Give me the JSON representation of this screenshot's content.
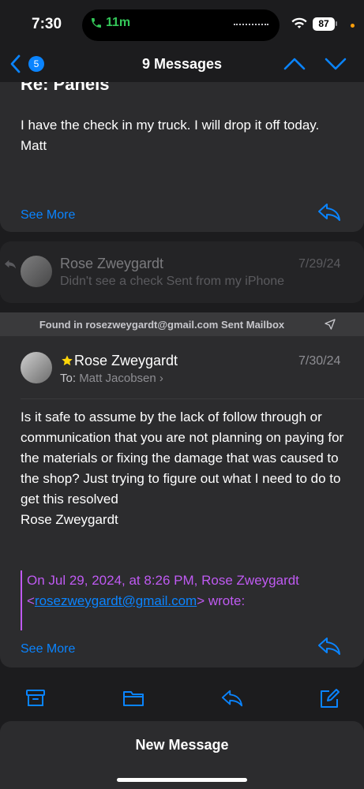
{
  "status": {
    "time": "7:30",
    "call": "11m",
    "battery": "87"
  },
  "nav": {
    "back_count": "5",
    "title": "9 Messages"
  },
  "message1": {
    "subject": "Re: Panels",
    "body": "I have the check in my truck.  I will drop it off today.\nMatt",
    "see_more": "See More"
  },
  "message2": {
    "sender": "Rose Zweygardt",
    "date": "7/29/24",
    "preview": "Didn't see a check Sent from my iPhone"
  },
  "found_in": "Found in rosezweygardt@gmail.com Sent Mailbox",
  "message3": {
    "sender": "Rose Zweygardt",
    "date": "7/30/24",
    "to_label": "To:",
    "to_name": "Matt Jacobsen",
    "body": "Is it safe to assume by the lack of follow through or communication that you are not planning on paying for the materials or fixing the damage that was caused to the shop? Just trying to figure out what I need to do to get this resolved\nRose Zweygardt",
    "quote_line1": "On Jul 29, 2024, at 8:26 PM, Rose Zweygardt",
    "quote_open": "<",
    "quote_email": "rosezweygardt@gmail.com",
    "quote_close": "> wrote:",
    "see_more": "See More"
  },
  "toolbar": {
    "new_message": "New Message"
  },
  "colors": {
    "accent": "#0a84ff",
    "quote": "#bf5af2",
    "star": "#ffd60a",
    "call": "#34c759"
  },
  "icons": [
    "phone-icon",
    "wifi-icon",
    "chevron-left-icon",
    "chevron-up-icon",
    "chevron-down-icon",
    "reply-icon",
    "star-icon",
    "send-arrow-icon",
    "archive-icon",
    "folder-icon",
    "compose-icon"
  ]
}
